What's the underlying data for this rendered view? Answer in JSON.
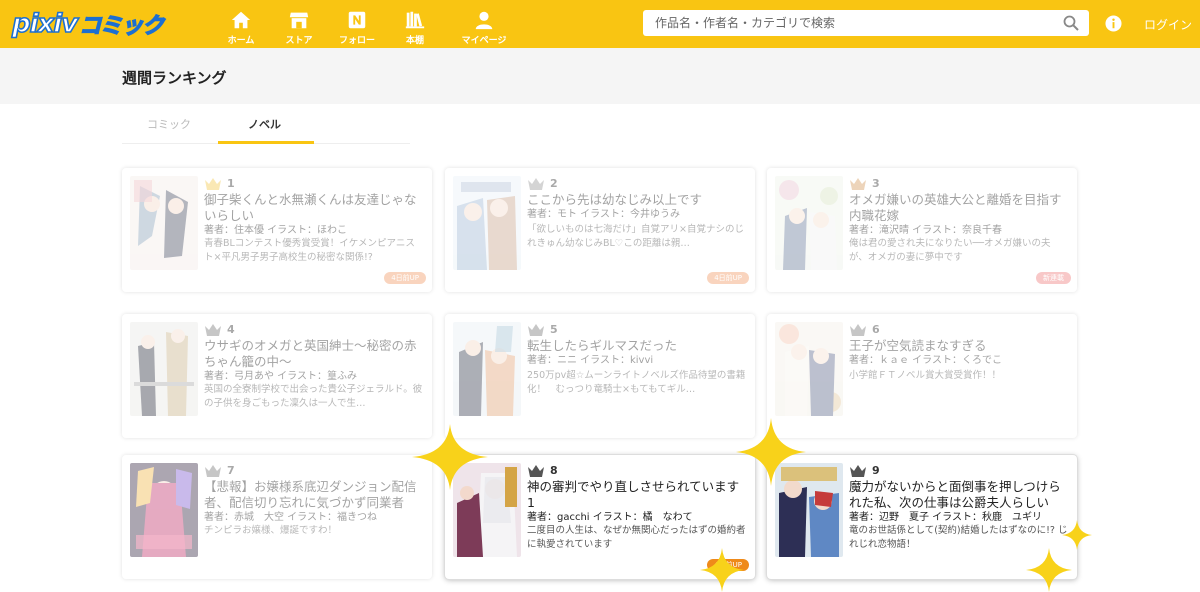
{
  "header": {
    "logo_text": "pixiv",
    "logo_sub": "コミック",
    "nav": [
      {
        "label": "ホーム",
        "icon": "home-icon"
      },
      {
        "label": "ストア",
        "icon": "store-icon"
      },
      {
        "label": "フォロー",
        "icon": "follow-icon"
      },
      {
        "label": "本棚",
        "icon": "bookshelf-icon"
      },
      {
        "label": "マイページ",
        "icon": "user-icon"
      }
    ],
    "search_placeholder": "作品名・作者名・カテゴリで検索",
    "login_label": "ログイン"
  },
  "page": {
    "title": "週間ランキング",
    "tabs": [
      {
        "label": "コミック",
        "active": false
      },
      {
        "label": "ノベル",
        "active": true
      }
    ]
  },
  "colors": {
    "brand": "#f9c512",
    "sparkle": "#f8d21a",
    "badge": "#f29a66"
  },
  "ranking": [
    {
      "rank": "1",
      "crown": "gold",
      "title": "御子柴くんと水無瀬くんは友達じゃないらしい",
      "meta": "著者：住本優 イラスト：ほわこ",
      "desc": "青春BLコンテスト優秀賞受賞！イケメンピアニスト×平凡男子男子高校生の秘密な関係!?",
      "badge": "4日前UP"
    },
    {
      "rank": "2",
      "crown": "silver",
      "title": "ここから先は幼なじみ以上です",
      "meta": "著者：モト イラスト：今井ゆうみ",
      "desc": "「欲しいものは七海だけ」自覚アリ×自覚ナシのじれきゅん幼なじみBL♡この距離は親…",
      "badge": "4日前UP"
    },
    {
      "rank": "3",
      "crown": "bronze",
      "title": "オメガ嫌いの英雄大公と離婚を目指す内職花嫁",
      "meta": "著者：滝沢晴 イラスト：奈良千春",
      "desc": "俺は君の愛され夫になりたい──オメガ嫌いの夫が、オメガの妻に夢中です",
      "badge": "新連載"
    },
    {
      "rank": "4",
      "crown": "grey",
      "title": "ウサギのオメガと英国紳士〜秘密の赤ちゃん籠の中〜",
      "meta": "著者：弓月あや イラスト：篁ふみ",
      "desc": "英国の全寮制学校で出会った貴公子ジェラルド。彼の子供を身ごもった凜久は一人で生…",
      "badge": ""
    },
    {
      "rank": "5",
      "crown": "grey",
      "title": "転生したらギルマスだった",
      "meta": "著者：ニニ イラスト：kivvi",
      "desc": "250万pv超☆ムーンライトノベルズ作品待望の書籍化！　むっつり竜騎士×もてもてギル…",
      "badge": ""
    },
    {
      "rank": "6",
      "crown": "grey",
      "title": "王子が空気読まなすぎる",
      "meta": "著者：ｋａｅ イラスト：くろでこ",
      "desc": "小学館ＦＴノベル賞大賞受賞作！！",
      "badge": ""
    },
    {
      "rank": "7",
      "crown": "grey",
      "title": "【悲報】お嬢様系底辺ダンジョン配信者、配信切り忘れに気づかず同業者を…",
      "meta": "著者：赤城　大空 イラスト：福きつね",
      "desc": "チンピラお嬢様、爆誕ですわ！",
      "badge": ""
    },
    {
      "rank": "8",
      "crown": "grey",
      "title": "神の審判でやり直しさせられています 1",
      "meta": "著者：gacchi イラスト：橘　なわて",
      "desc": "二度目の人生は、なぜか無関心だったはずの婚約者に執愛されています",
      "badge": "4日前UP"
    },
    {
      "rank": "9",
      "crown": "grey",
      "title": "魔力がないからと面倒事を押しつけられた私、次の仕事は公爵夫人らしいで…",
      "meta": "著者：辺野　夏子 イラスト：秋鹿　ユギリ",
      "desc": "竜のお世話係として(契約)結婚したはずなのに!? じれじれ恋物語！",
      "badge": ""
    }
  ]
}
